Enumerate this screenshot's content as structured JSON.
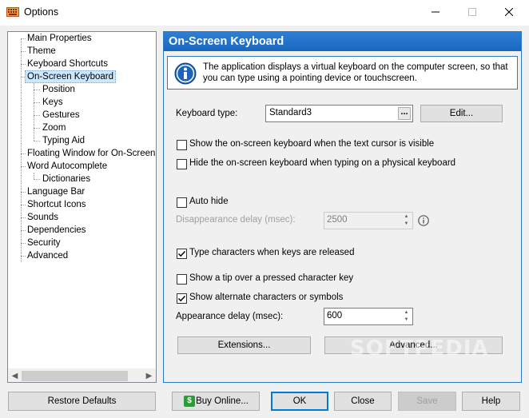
{
  "window": {
    "title": "Options"
  },
  "tree": {
    "items": [
      {
        "label": "Main Properties"
      },
      {
        "label": "Theme"
      },
      {
        "label": "Keyboard Shortcuts"
      },
      {
        "label": "On-Screen Keyboard"
      },
      {
        "label": "Position"
      },
      {
        "label": "Keys"
      },
      {
        "label": "Gestures"
      },
      {
        "label": "Zoom"
      },
      {
        "label": "Typing Aid"
      },
      {
        "label": "Floating Window for On-Screen Keyboard"
      },
      {
        "label": "Word Autocomplete"
      },
      {
        "label": "Dictionaries"
      },
      {
        "label": "Language Bar"
      },
      {
        "label": "Shortcut Icons"
      },
      {
        "label": "Sounds"
      },
      {
        "label": "Dependencies"
      },
      {
        "label": "Security"
      },
      {
        "label": "Advanced"
      }
    ],
    "selected": "On-Screen Keyboard"
  },
  "panel": {
    "header": "On-Screen Keyboard",
    "info": "The application displays a virtual keyboard on the computer screen, so that you can type using a pointing device or touchscreen.",
    "keyboard_type_label": "Keyboard type:",
    "keyboard_type_value": "Standard3",
    "keyboard_type_more": "...",
    "edit_label": "Edit...",
    "show_on_cursor": {
      "label": "Show the on-screen keyboard when the text cursor is visible",
      "checked": false
    },
    "hide_on_physical": {
      "label": "Hide the on-screen keyboard when typing on a physical keyboard",
      "checked": false
    },
    "auto_hide": {
      "label": "Auto hide",
      "checked": false
    },
    "disappearance_label": "Disappearance delay (msec):",
    "disappearance_value": "2500",
    "type_on_release": {
      "label": "Type characters when keys are released",
      "checked": true
    },
    "show_tip": {
      "label": "Show a tip over a pressed character key",
      "checked": false
    },
    "show_alternate": {
      "label": "Show alternate characters or symbols",
      "checked": true
    },
    "appearance_label": "Appearance delay (msec):",
    "appearance_value": "600",
    "extensions_label": "Extensions...",
    "advanced_label": "Advanced..."
  },
  "footer": {
    "restore_label": "Restore Defaults",
    "buy_label": "Buy Online...",
    "ok_label": "OK",
    "close_label": "Close",
    "save_label": "Save",
    "help_label": "Help"
  },
  "watermark": "SOFTPEDIA",
  "colors": {
    "accent": "#1a66bf",
    "selected_bg": "#cce8ff",
    "buy_icon": "#2e9b38"
  }
}
